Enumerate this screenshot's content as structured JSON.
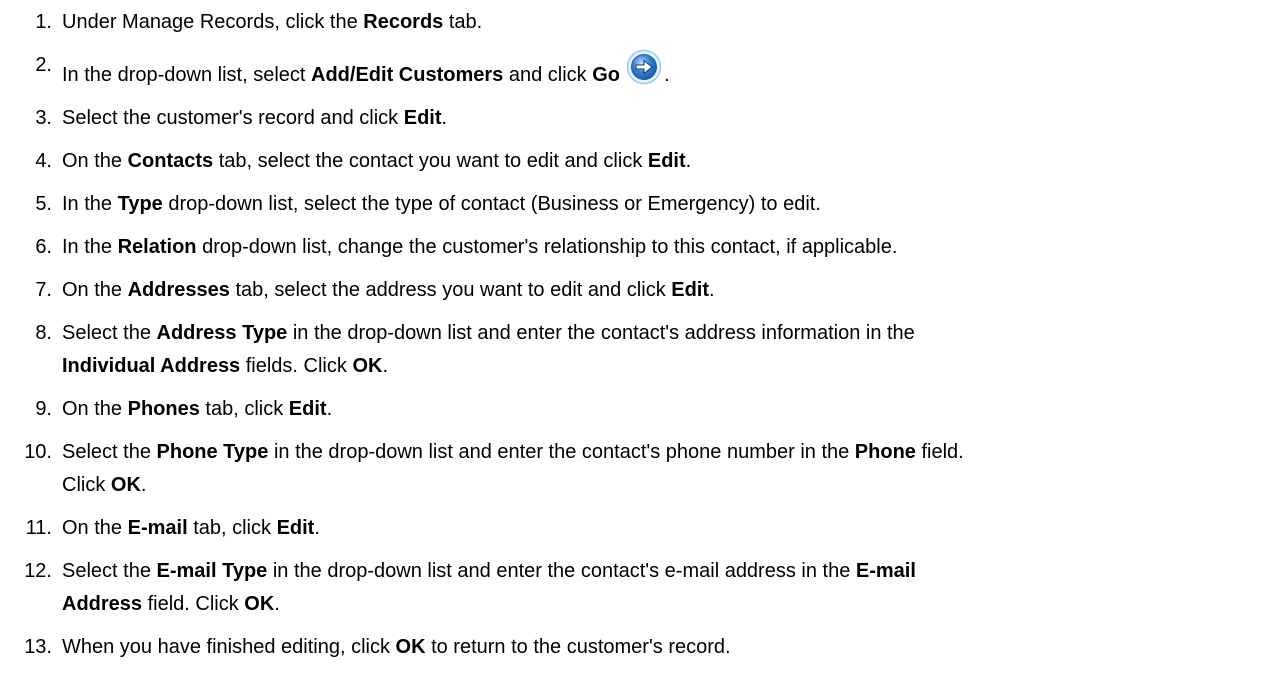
{
  "steps": [
    {
      "num": "1.",
      "segments": [
        {
          "text": "Under Manage Records, click the ",
          "bold": false
        },
        {
          "text": "Records",
          "bold": true
        },
        {
          "text": " tab.",
          "bold": false
        }
      ]
    },
    {
      "num": "2.",
      "segments": [
        {
          "text": "In the drop-down list, select ",
          "bold": false
        },
        {
          "text": "Add/Edit Customers",
          "bold": true
        },
        {
          "text": " and click ",
          "bold": false
        },
        {
          "text": "Go",
          "bold": true
        },
        {
          "icon": "go-arrow-icon"
        },
        {
          "text": ".",
          "bold": false
        }
      ]
    },
    {
      "num": "3.",
      "segments": [
        {
          "text": "Select the customer's record and click ",
          "bold": false
        },
        {
          "text": "Edit",
          "bold": true
        },
        {
          "text": ".",
          "bold": false
        }
      ]
    },
    {
      "num": "4.",
      "segments": [
        {
          "text": "On the ",
          "bold": false
        },
        {
          "text": "Contacts",
          "bold": true
        },
        {
          "text": " tab, select the contact you want to edit and click ",
          "bold": false
        },
        {
          "text": "Edit",
          "bold": true
        },
        {
          "text": ".",
          "bold": false
        }
      ]
    },
    {
      "num": "5.",
      "segments": [
        {
          "text": "In the ",
          "bold": false
        },
        {
          "text": "Type",
          "bold": true
        },
        {
          "text": " drop-down list, select the type of contact (Business or Emergency) to edit.",
          "bold": false
        }
      ]
    },
    {
      "num": "6.",
      "segments": [
        {
          "text": "In the ",
          "bold": false
        },
        {
          "text": "Relation",
          "bold": true
        },
        {
          "text": " drop-down list, change the customer's relationship to this contact, if applicable.",
          "bold": false
        }
      ]
    },
    {
      "num": "7.",
      "segments": [
        {
          "text": "On the ",
          "bold": false
        },
        {
          "text": "Addresses",
          "bold": true
        },
        {
          "text": " tab, select the address you want to edit and click ",
          "bold": false
        },
        {
          "text": "Edit",
          "bold": true
        },
        {
          "text": ".",
          "bold": false
        }
      ]
    },
    {
      "num": "8.",
      "lines": [
        [
          {
            "text": "Select the ",
            "bold": false
          },
          {
            "text": "Address Type",
            "bold": true
          },
          {
            "text": " in the drop-down list and enter the contact's address information in the",
            "bold": false
          }
        ],
        [
          {
            "text": "Individual Address",
            "bold": true
          },
          {
            "text": " fields. Click ",
            "bold": false
          },
          {
            "text": "OK",
            "bold": true
          },
          {
            "text": ".",
            "bold": false
          }
        ]
      ]
    },
    {
      "num": "9.",
      "segments": [
        {
          "text": "On the ",
          "bold": false
        },
        {
          "text": "Phones",
          "bold": true
        },
        {
          "text": " tab, click ",
          "bold": false
        },
        {
          "text": "Edit",
          "bold": true
        },
        {
          "text": ".",
          "bold": false
        }
      ]
    },
    {
      "num": "10.",
      "lines": [
        [
          {
            "text": "Select the ",
            "bold": false
          },
          {
            "text": "Phone Type",
            "bold": true
          },
          {
            "text": " in the drop-down list and enter the contact's phone number in the ",
            "bold": false
          },
          {
            "text": "Phone",
            "bold": true
          },
          {
            "text": " field.",
            "bold": false
          }
        ],
        [
          {
            "text": "Click ",
            "bold": false
          },
          {
            "text": "OK",
            "bold": true
          },
          {
            "text": ".",
            "bold": false
          }
        ]
      ]
    },
    {
      "num": "11.",
      "segments": [
        {
          "text": "On the ",
          "bold": false
        },
        {
          "text": "E-mail",
          "bold": true
        },
        {
          "text": " tab, click ",
          "bold": false
        },
        {
          "text": "Edit",
          "bold": true
        },
        {
          "text": ".",
          "bold": false
        }
      ]
    },
    {
      "num": "12.",
      "lines": [
        [
          {
            "text": "Select the ",
            "bold": false
          },
          {
            "text": "E-mail Type",
            "bold": true
          },
          {
            "text": " in the drop-down list and enter the contact's e-mail address in the ",
            "bold": false
          },
          {
            "text": "E-mail",
            "bold": true
          }
        ],
        [
          {
            "text": "Address",
            "bold": true
          },
          {
            "text": " field. Click ",
            "bold": false
          },
          {
            "text": "OK",
            "bold": true
          },
          {
            "text": ".",
            "bold": false
          }
        ]
      ]
    },
    {
      "num": "13.",
      "segments": [
        {
          "text": "When you have finished editing, click ",
          "bold": false
        },
        {
          "text": "OK",
          "bold": true
        },
        {
          "text": " to return to the customer's record.",
          "bold": false
        }
      ]
    }
  ],
  "colors": {
    "text": "#000000",
    "go_icon_fill": "#2f7fd6",
    "go_icon_ring": "#9cc7f0"
  }
}
